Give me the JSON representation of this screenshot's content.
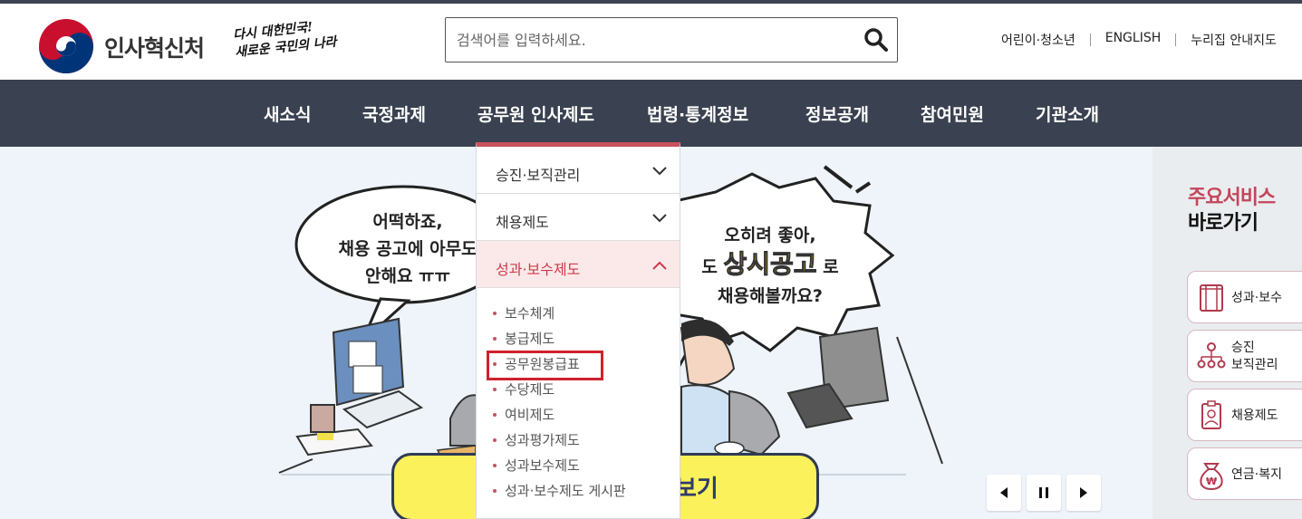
{
  "header": {
    "org_name": "인사혁신처",
    "slogan_line1": "다시 대한민국!",
    "slogan_line2": "새로운 국민의 나라",
    "search": {
      "placeholder": "검색어를 입력하세요."
    },
    "util_links": [
      "어린이·청소년",
      "ENGLISH",
      "누리집 안내지도"
    ]
  },
  "gnb": {
    "items": [
      "새소식",
      "국정과제",
      "공무원 인사제도",
      "법령·통계정보",
      "정보공개",
      "참여민원",
      "기관소개"
    ]
  },
  "dropdown": {
    "sections": [
      {
        "label": "승진·보직관리",
        "expanded": false
      },
      {
        "label": "채용제도",
        "expanded": false
      },
      {
        "label": "성과·보수제도",
        "expanded": true
      }
    ],
    "sub_items": [
      "보수체계",
      "봉급제도",
      "공무원봉급표",
      "수당제도",
      "여비제도",
      "성과평가제도",
      "성과보수제도",
      "성과·보수제도 게시판"
    ],
    "highlighted_item": "공무원봉급표"
  },
  "hero": {
    "bubble1_line1": "어떡하죠,",
    "bubble1_line2": "채용 공고에 아무도",
    "bubble1_line3": "안해요 ㅠㅠ",
    "bubble2_line1": "오히려 좋아,",
    "bubble2_pre": "도",
    "bubble2_highlight": "상시공고",
    "bubble2_post": "로",
    "bubble2_line3": "채용해볼까요?",
    "cta_label": "보기",
    "controls": [
      "prev",
      "pause",
      "next"
    ]
  },
  "quick": {
    "title_line1": "주요서비스",
    "title_line2": "바로가기",
    "buttons": [
      {
        "label": "성과·보수",
        "icon": "document-icon"
      },
      {
        "label_line1": "승진",
        "label_line2": "보직관리",
        "icon": "org-chart-icon"
      },
      {
        "label": "채용제도",
        "icon": "id-badge-icon"
      },
      {
        "label": "연금·복지",
        "icon": "money-bag-icon"
      }
    ]
  },
  "colors": {
    "gnb_bg": "#3a4150",
    "accent": "#c9525f",
    "highlight_box": "#d0212d",
    "cta_bg": "#fbf15a"
  }
}
